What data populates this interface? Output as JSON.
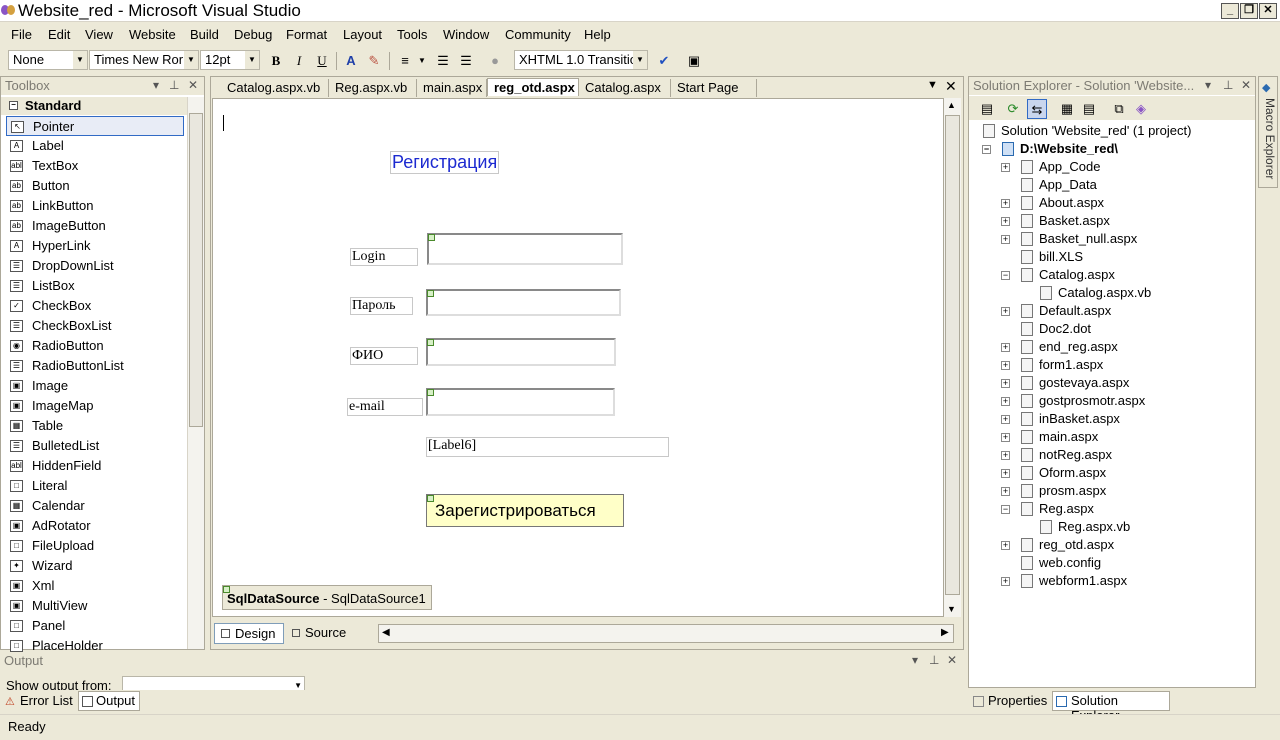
{
  "window": {
    "title": "Website_red - Microsoft Visual Studio"
  },
  "menu": [
    "File",
    "Edit",
    "View",
    "Website",
    "Build",
    "Debug",
    "Format",
    "Layout",
    "Tools",
    "Window",
    "Community",
    "Help"
  ],
  "format_toolbar": {
    "block_format": "None",
    "font_name": "Times New Ror",
    "font_size": "12pt",
    "bold": "B",
    "italic": "I",
    "underline": "U",
    "doctype": "XHTML 1.0 Transitio"
  },
  "toolbox": {
    "title": "Toolbox",
    "category": "Standard",
    "items": [
      "Pointer",
      "Label",
      "TextBox",
      "Button",
      "LinkButton",
      "ImageButton",
      "HyperLink",
      "DropDownList",
      "ListBox",
      "CheckBox",
      "CheckBoxList",
      "RadioButton",
      "RadioButtonList",
      "Image",
      "ImageMap",
      "Table",
      "BulletedList",
      "HiddenField",
      "Literal",
      "Calendar",
      "AdRotator",
      "FileUpload",
      "Wizard",
      "Xml",
      "MultiView",
      "Panel",
      "PlaceHolder"
    ],
    "icons": [
      "↖",
      "A",
      "abl",
      "ab",
      "ab",
      "ab",
      "A",
      "☰",
      "☰",
      "✓",
      "☰",
      "◉",
      "☰",
      "▣",
      "▣",
      "▦",
      "☰",
      "abl",
      "□",
      "▦",
      "▣",
      "□",
      "✦",
      "▣",
      "▣",
      "□",
      "□"
    ]
  },
  "editor": {
    "tabs": [
      "Catalog.aspx.vb",
      "Reg.aspx.vb",
      "main.aspx",
      "reg_otd.aspx",
      "Catalog.aspx",
      "Start Page"
    ],
    "active_tab": "reg_otd.aspx",
    "form": {
      "heading": "Регистрация",
      "login_label": "Login",
      "password_label": "Пароль",
      "fio_label": "ФИО",
      "email_label": "e-mail",
      "result_label": "[Label6]",
      "submit_button": "Зарегистрироваться",
      "datasource_type": "SqlDataSource",
      "datasource_name": " - SqlDataSource1"
    },
    "view_tabs": {
      "design": "Design",
      "source": "Source"
    }
  },
  "solution_explorer": {
    "title": "Solution Explorer - Solution 'Website...",
    "solution": "Solution 'Website_red' (1 project)",
    "project": "D:\\Website_red\\",
    "items": [
      {
        "name": "App_Code",
        "expander": "+",
        "indent": 1
      },
      {
        "name": "App_Data",
        "expander": "",
        "indent": 1
      },
      {
        "name": "About.aspx",
        "expander": "+",
        "indent": 1
      },
      {
        "name": "Basket.aspx",
        "expander": "+",
        "indent": 1
      },
      {
        "name": "Basket_null.aspx",
        "expander": "+",
        "indent": 1
      },
      {
        "name": "bill.XLS",
        "expander": "",
        "indent": 1
      },
      {
        "name": "Catalog.aspx",
        "expander": "-",
        "indent": 1
      },
      {
        "name": "Catalog.aspx.vb",
        "expander": "",
        "indent": 2
      },
      {
        "name": "Default.aspx",
        "expander": "+",
        "indent": 1
      },
      {
        "name": "Doc2.dot",
        "expander": "",
        "indent": 1
      },
      {
        "name": "end_reg.aspx",
        "expander": "+",
        "indent": 1
      },
      {
        "name": "form1.aspx",
        "expander": "+",
        "indent": 1
      },
      {
        "name": "gostevaya.aspx",
        "expander": "+",
        "indent": 1
      },
      {
        "name": "gostprosmotr.aspx",
        "expander": "+",
        "indent": 1
      },
      {
        "name": "inBasket.aspx",
        "expander": "+",
        "indent": 1
      },
      {
        "name": "main.aspx",
        "expander": "+",
        "indent": 1
      },
      {
        "name": "notReg.aspx",
        "expander": "+",
        "indent": 1
      },
      {
        "name": "Oform.aspx",
        "expander": "+",
        "indent": 1
      },
      {
        "name": "prosm.aspx",
        "expander": "+",
        "indent": 1
      },
      {
        "name": "Reg.aspx",
        "expander": "-",
        "indent": 1
      },
      {
        "name": "Reg.aspx.vb",
        "expander": "",
        "indent": 2
      },
      {
        "name": "reg_otd.aspx",
        "expander": "+",
        "indent": 1
      },
      {
        "name": "web.config",
        "expander": "",
        "indent": 1
      },
      {
        "name": "webform1.aspx",
        "expander": "+",
        "indent": 1
      }
    ],
    "bottom_tabs": [
      "Properties",
      "Solution Explorer"
    ]
  },
  "macro_explorer": {
    "label": "Macro Explorer"
  },
  "output": {
    "title": "Output",
    "show_from_label": "Show output from:"
  },
  "bottom_tabs": [
    "Error List",
    "Output"
  ],
  "status": {
    "text": "Ready"
  }
}
